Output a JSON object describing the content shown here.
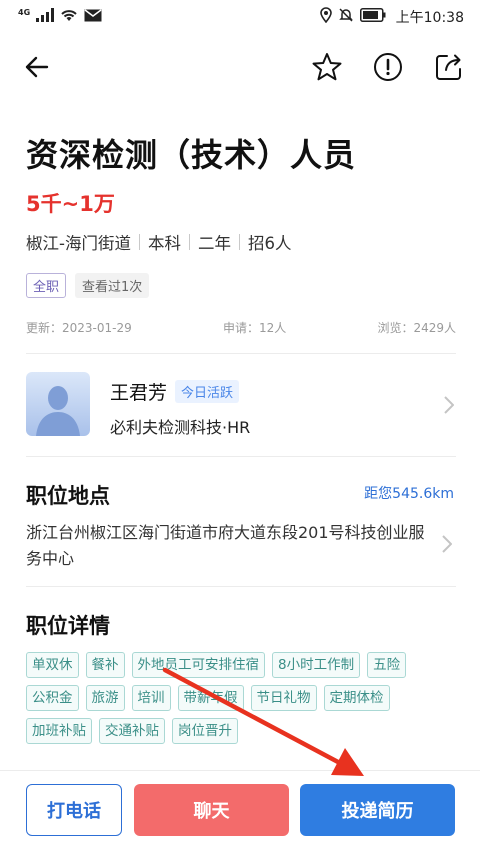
{
  "status_bar": {
    "network": "4G",
    "time": "上午10:38"
  },
  "nav": {
    "icons": [
      "back-icon",
      "star-icon",
      "report-icon",
      "share-icon"
    ]
  },
  "job": {
    "title": "资深检测（技术）人员",
    "salary": "5千~1万",
    "meta": [
      "椒江-海门街道",
      "本科",
      "二年",
      "招6人"
    ],
    "type_tag": "全职",
    "views_tag": "查看过1次",
    "updated": "更新：2023-01-29",
    "applications": "申请：12人",
    "views": "浏览：2429人"
  },
  "recruiter": {
    "name": "王君芳",
    "active_badge": "今日活跃",
    "company": "必利夫检测科技·HR"
  },
  "location": {
    "title": "职位地点",
    "distance": "距您545.6km",
    "address": "浙江台州椒江区海门街道市府大道东段201号科技创业服务中心"
  },
  "details": {
    "title": "职位详情",
    "benefits": [
      "单双休",
      "餐补",
      "外地员工可安排住宿",
      "8小时工作制",
      "五险",
      "公积金",
      "旅游",
      "培训",
      "带薪年假",
      "节日礼物",
      "定期体检",
      "加班补贴",
      "交通补贴",
      "岗位晋升"
    ]
  },
  "actions": {
    "call": "打电话",
    "chat": "聊天",
    "apply": "投递简历"
  },
  "colors": {
    "salary": "#e5322d",
    "accent_blue": "#2f7de1",
    "chat_red": "#f36b6b",
    "benefit_teal": "#3b8f88",
    "annotation_arrow": "#e8321f"
  }
}
